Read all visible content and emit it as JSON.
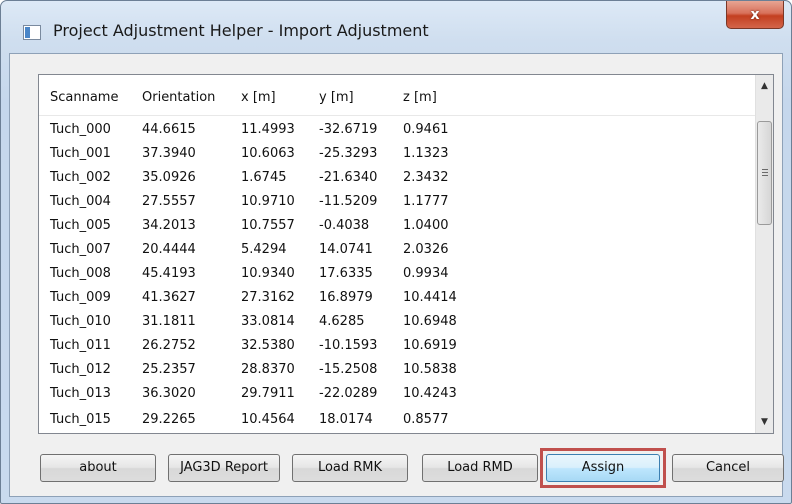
{
  "window": {
    "title": "Project Adjustment Helper - Import Adjustment",
    "close_glyph": "x"
  },
  "table": {
    "columns": [
      "Scanname",
      "Orientation",
      "x [m]",
      "y [m]",
      "z [m]"
    ],
    "rows": [
      [
        "Tuch_000",
        "44.6615",
        "11.4993",
        "-32.6719",
        "0.9461"
      ],
      [
        "Tuch_001",
        "37.3940",
        "10.6063",
        "-25.3293",
        "1.1323"
      ],
      [
        "Tuch_002",
        "35.0926",
        "1.6745",
        "-21.6340",
        "2.3432"
      ],
      [
        "Tuch_004",
        "27.5557",
        "10.9710",
        "-11.5209",
        "1.1777"
      ],
      [
        "Tuch_005",
        "34.2013",
        "10.7557",
        "-0.4038",
        "1.0400"
      ],
      [
        "Tuch_007",
        "20.4444",
        "5.4294",
        "14.0741",
        "2.0326"
      ],
      [
        "Tuch_008",
        "45.4193",
        "10.9340",
        "17.6335",
        "0.9934"
      ],
      [
        "Tuch_009",
        "41.3627",
        "27.3162",
        "16.8979",
        "10.4414"
      ],
      [
        "Tuch_010",
        "31.1811",
        "33.0814",
        "4.6285",
        "10.6948"
      ],
      [
        "Tuch_011",
        "26.2752",
        "32.5380",
        "-10.1593",
        "10.6919"
      ],
      [
        "Tuch_012",
        "25.2357",
        "28.8370",
        "-15.2508",
        "10.5838"
      ],
      [
        "Tuch_013",
        "36.3020",
        "29.7911",
        "-22.0289",
        "10.4243"
      ],
      [
        "Tuch_015",
        "29.2265",
        "10.4564",
        "18.0174",
        "0.8577"
      ]
    ]
  },
  "scrollbar": {
    "up_glyph": "▲",
    "down_glyph": "▼"
  },
  "buttons": {
    "about": "about",
    "jag3d_report": "JAG3D Report",
    "load_rmk": "Load RMK",
    "load_rmd": "Load RMD",
    "assign": "Assign",
    "cancel": "Cancel"
  },
  "icons": {
    "app": "app-window-icon",
    "close": "close-icon"
  },
  "colors": {
    "highlight": "#c0504d",
    "close_button": "#c33f20"
  }
}
